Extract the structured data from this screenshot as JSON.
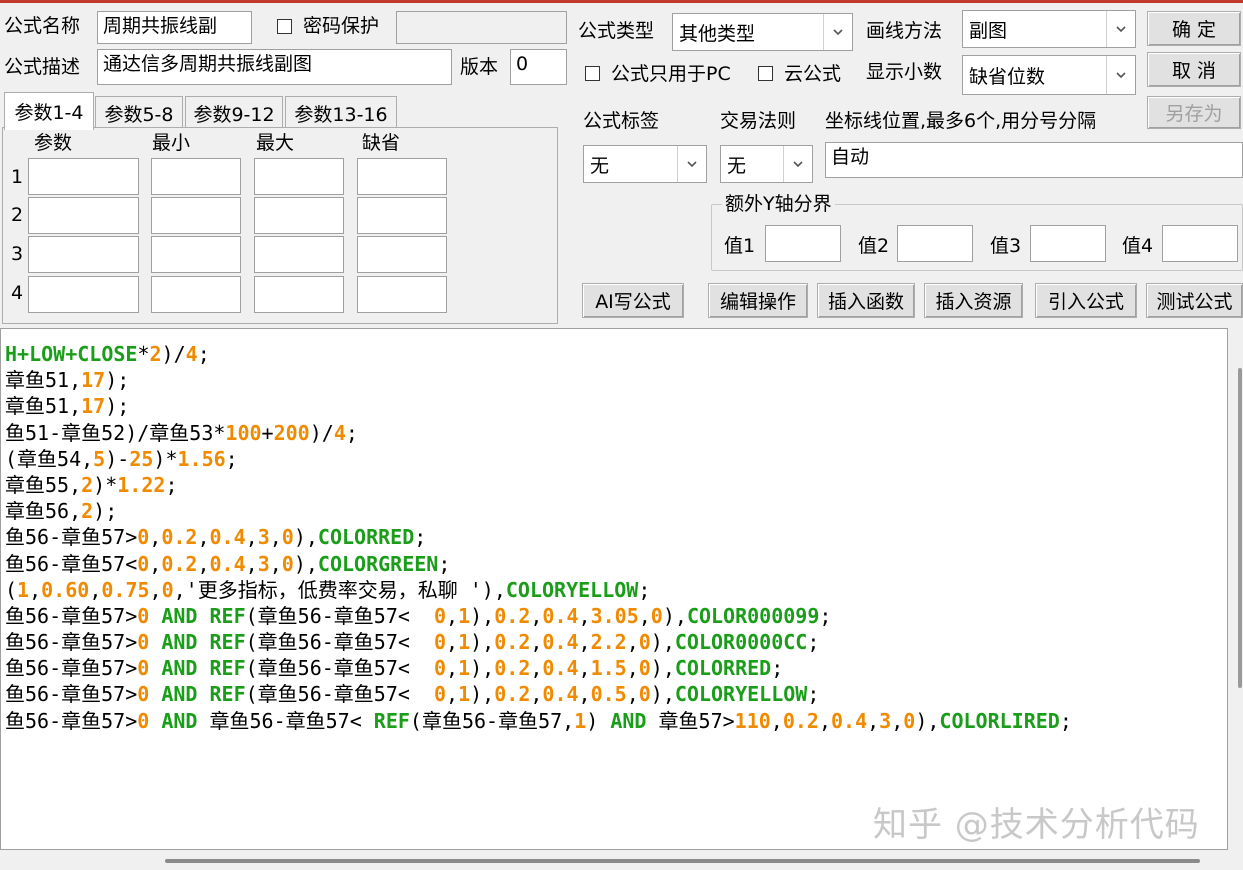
{
  "form": {
    "name_label": "公式名称",
    "name_value": "周期共振线副",
    "password_label": "密码保护",
    "password_value": "",
    "desc_label": "公式描述",
    "desc_value": "通达信多周期共振线副图",
    "version_label": "版本",
    "version_value": "0",
    "type_label": "公式类型",
    "type_value": "其他类型",
    "draw_label": "画线方法",
    "draw_value": "副图",
    "pc_only_label": "公式只用于PC",
    "cloud_label": "云公式",
    "decimals_label": "显示小数",
    "decimals_value": "缺省位数",
    "tag_label": "公式标签",
    "tag_value": "无",
    "rule_label": "交易法则",
    "rule_value": "无",
    "coord_label": "坐标线位置,最多6个,用分号分隔",
    "coord_value": "自动",
    "yaxis_group_label": "额外Y轴分界",
    "y_labels": [
      "值1",
      "值2",
      "值3",
      "值4"
    ]
  },
  "buttons": {
    "ok": "确  定",
    "cancel": "取  消",
    "save_as": "另存为",
    "ai_write": "AI写公式",
    "edit_ops": "编辑操作",
    "insert_func": "插入函数",
    "insert_res": "插入资源",
    "import_formula": "引入公式",
    "test_formula": "测试公式"
  },
  "tabs": [
    "参数1-4",
    "参数5-8",
    "参数9-12",
    "参数13-16"
  ],
  "param_headers": [
    "参数",
    "最小",
    "最大",
    "缺省"
  ],
  "param_rows": [
    "1",
    "2",
    "3",
    "4"
  ],
  "code_lines": [
    [
      [
        "g",
        "H+LOW+CLOSE"
      ],
      [
        "k",
        "*"
      ],
      [
        "o",
        "2"
      ],
      [
        "k",
        ")/"
      ],
      [
        "o",
        "4"
      ],
      [
        "k",
        ";"
      ]
    ],
    [
      [
        "p",
        "章鱼51,"
      ],
      [
        "o",
        "17"
      ],
      [
        "k",
        ");"
      ]
    ],
    [
      [
        "p",
        "章鱼51,"
      ],
      [
        "o",
        "17"
      ],
      [
        "k",
        ");"
      ]
    ],
    [
      [
        "p",
        "鱼51-章鱼52)/章鱼53*"
      ],
      [
        "o",
        "100"
      ],
      [
        "k",
        "+"
      ],
      [
        "o",
        "200"
      ],
      [
        "k",
        ")/"
      ],
      [
        "o",
        "4"
      ],
      [
        "k",
        ";"
      ]
    ],
    [
      [
        "p",
        "(章鱼54,"
      ],
      [
        "o",
        "5"
      ],
      [
        "k",
        ")-"
      ],
      [
        "o",
        "25"
      ],
      [
        "k",
        ")*"
      ],
      [
        "o",
        "1.56"
      ],
      [
        "k",
        ";"
      ]
    ],
    [
      [
        "p",
        "章鱼55,"
      ],
      [
        "o",
        "2"
      ],
      [
        "k",
        ")*"
      ],
      [
        "o",
        "1.22"
      ],
      [
        "k",
        ";"
      ]
    ],
    [
      [
        "p",
        "章鱼56,"
      ],
      [
        "o",
        "2"
      ],
      [
        "k",
        ");"
      ]
    ],
    [
      [
        "p",
        "鱼56-章鱼57>"
      ],
      [
        "o",
        "0"
      ],
      [
        "k",
        ","
      ],
      [
        "o",
        "0.2"
      ],
      [
        "k",
        ","
      ],
      [
        "o",
        "0.4"
      ],
      [
        "k",
        ","
      ],
      [
        "o",
        "3"
      ],
      [
        "k",
        ","
      ],
      [
        "o",
        "0"
      ],
      [
        "k",
        "),"
      ],
      [
        "g",
        "COLORRED"
      ],
      [
        "k",
        ";"
      ]
    ],
    [
      [
        "p",
        "鱼56-章鱼57<"
      ],
      [
        "o",
        "0"
      ],
      [
        "k",
        ","
      ],
      [
        "o",
        "0.2"
      ],
      [
        "k",
        ","
      ],
      [
        "o",
        "0.4"
      ],
      [
        "k",
        ","
      ],
      [
        "o",
        "3"
      ],
      [
        "k",
        ","
      ],
      [
        "o",
        "0"
      ],
      [
        "k",
        "),"
      ],
      [
        "g",
        "COLORGREEN"
      ],
      [
        "k",
        ";"
      ]
    ],
    [
      [
        "k",
        "("
      ],
      [
        "o",
        "1"
      ],
      [
        "k",
        ","
      ],
      [
        "o",
        "0.60"
      ],
      [
        "k",
        ","
      ],
      [
        "o",
        "0.75"
      ],
      [
        "k",
        ","
      ],
      [
        "o",
        "0"
      ],
      [
        "p",
        ",'更多指标，低费率交易，私聊 '),"
      ],
      [
        "g",
        "COLORYELLOW"
      ],
      [
        "k",
        ";"
      ]
    ],
    [
      [
        "p",
        "鱼56-章鱼57>"
      ],
      [
        "o",
        "0"
      ],
      [
        "g",
        " AND REF"
      ],
      [
        "p",
        "(章鱼56-章鱼57<  "
      ],
      [
        "o",
        "0"
      ],
      [
        "k",
        ","
      ],
      [
        "o",
        "1"
      ],
      [
        "k",
        "),"
      ],
      [
        "o",
        "0.2"
      ],
      [
        "k",
        ","
      ],
      [
        "o",
        "0.4"
      ],
      [
        "k",
        ","
      ],
      [
        "o",
        "3.05"
      ],
      [
        "k",
        ","
      ],
      [
        "o",
        "0"
      ],
      [
        "k",
        "),"
      ],
      [
        "g",
        "COLOR000099"
      ],
      [
        "k",
        ";"
      ]
    ],
    [
      [
        "p",
        "鱼56-章鱼57>"
      ],
      [
        "o",
        "0"
      ],
      [
        "g",
        " AND REF"
      ],
      [
        "p",
        "(章鱼56-章鱼57<  "
      ],
      [
        "o",
        "0"
      ],
      [
        "k",
        ","
      ],
      [
        "o",
        "1"
      ],
      [
        "k",
        "),"
      ],
      [
        "o",
        "0.2"
      ],
      [
        "k",
        ","
      ],
      [
        "o",
        "0.4"
      ],
      [
        "k",
        ","
      ],
      [
        "o",
        "2.2"
      ],
      [
        "k",
        ","
      ],
      [
        "o",
        "0"
      ],
      [
        "k",
        "),"
      ],
      [
        "g",
        "COLOR0000CC"
      ],
      [
        "k",
        ";"
      ]
    ],
    [
      [
        "p",
        "鱼56-章鱼57>"
      ],
      [
        "o",
        "0"
      ],
      [
        "g",
        " AND REF"
      ],
      [
        "p",
        "(章鱼56-章鱼57<  "
      ],
      [
        "o",
        "0"
      ],
      [
        "k",
        ","
      ],
      [
        "o",
        "1"
      ],
      [
        "k",
        "),"
      ],
      [
        "o",
        "0.2"
      ],
      [
        "k",
        ","
      ],
      [
        "o",
        "0.4"
      ],
      [
        "k",
        ","
      ],
      [
        "o",
        "1.5"
      ],
      [
        "k",
        ","
      ],
      [
        "o",
        "0"
      ],
      [
        "k",
        "),"
      ],
      [
        "g",
        "COLORRED"
      ],
      [
        "k",
        ";"
      ]
    ],
    [
      [
        "p",
        "鱼56-章鱼57>"
      ],
      [
        "o",
        "0"
      ],
      [
        "g",
        " AND REF"
      ],
      [
        "p",
        "(章鱼56-章鱼57<  "
      ],
      [
        "o",
        "0"
      ],
      [
        "k",
        ","
      ],
      [
        "o",
        "1"
      ],
      [
        "k",
        "),"
      ],
      [
        "o",
        "0.2"
      ],
      [
        "k",
        ","
      ],
      [
        "o",
        "0.4"
      ],
      [
        "k",
        ","
      ],
      [
        "o",
        "0.5"
      ],
      [
        "k",
        ","
      ],
      [
        "o",
        "0"
      ],
      [
        "k",
        "),"
      ],
      [
        "g",
        "COLORYELLOW"
      ],
      [
        "k",
        ";"
      ]
    ],
    [
      [
        "p",
        "鱼56-章鱼57>"
      ],
      [
        "o",
        "0"
      ],
      [
        "g",
        " AND"
      ],
      [
        "p",
        " 章鱼56-章鱼57< "
      ],
      [
        "g",
        "REF"
      ],
      [
        "p",
        "(章鱼56-章鱼57,"
      ],
      [
        "o",
        "1"
      ],
      [
        "k",
        ")"
      ],
      [
        "g",
        " AND"
      ],
      [
        "p",
        " 章鱼57>"
      ],
      [
        "o",
        "110"
      ],
      [
        "k",
        ","
      ],
      [
        "o",
        "0.2"
      ],
      [
        "k",
        ","
      ],
      [
        "o",
        "0.4"
      ],
      [
        "k",
        ","
      ],
      [
        "o",
        "3"
      ],
      [
        "k",
        ","
      ],
      [
        "o",
        "0"
      ],
      [
        "k",
        "),"
      ],
      [
        "g",
        "COLORLIRED"
      ],
      [
        "k",
        ";"
      ]
    ]
  ],
  "watermark": "知乎 @技术分析代码"
}
